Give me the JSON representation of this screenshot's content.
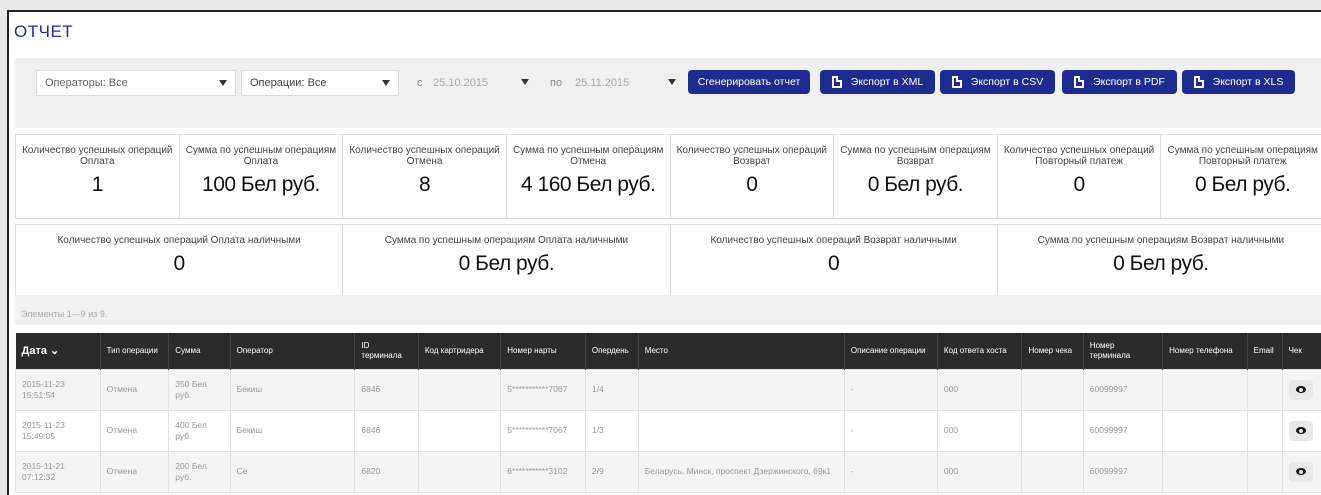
{
  "title": "ОТЧЕТ",
  "filters": {
    "operators": "Операторы: Все",
    "operations": "Операции: Все",
    "from_label": "с",
    "from_date": "25.10.2015",
    "to_label": "по",
    "to_date": "25.11.2015",
    "generate": "Сгенерировать отчет",
    "export_xml": "Экспорт в XML",
    "export_csv": "Экспорт в CSV",
    "export_pdf": "Экспорт в PDF",
    "export_xls": "Экспорт в XLS"
  },
  "stats_row1": [
    {
      "label": "Количество успешных операций Оплата",
      "value": "1"
    },
    {
      "label": "Сумма по успешным операциям Оплата",
      "value": "100 Бел руб."
    },
    {
      "label": "Количество успешных операций Отмена",
      "value": "8"
    },
    {
      "label": "Сумма по успешным операциям Отмена",
      "value": "4 160 Бел руб."
    },
    {
      "label": "Количество успешных операций Возврат",
      "value": "0"
    },
    {
      "label": "Сумма по успешным операциям Возврат",
      "value": "0 Бел руб."
    },
    {
      "label": "Количество успешных операций Повторный платеж",
      "value": "0"
    },
    {
      "label": "Сумма по успешным операциям Повторный платеж",
      "value": "0 Бел руб."
    }
  ],
  "stats_row2": [
    {
      "label": "Количество успешных операций Оплата наличными",
      "value": "0"
    },
    {
      "label": "Сумма по успешным операциям Оплата наличными",
      "value": "0 Бел руб."
    },
    {
      "label": "Количество успешных операций Возврат наличными",
      "value": "0"
    },
    {
      "label": "Сумма по успешным операциям Возврат наличными",
      "value": "0 Бел руб."
    }
  ],
  "count_text": "Элементы 1—9 из 9.",
  "table": {
    "headers": [
      "Дата",
      "Тип операции",
      "Сумма",
      "Оператор",
      "ID терминала",
      "Код картридера",
      "Номер нарты",
      "Опердень",
      "Место",
      "Описание операции",
      "Код ответа хоста",
      "Номер чека",
      "Номер терминала",
      "Номер телефона",
      "Email",
      "Чек"
    ],
    "rows": [
      [
        "2015-11-23 15:51:54",
        "Отмена",
        "350 Бел руб.",
        "Бекиш",
        "6846",
        "",
        "5***********7067",
        "1/4",
        "",
        "-",
        "000",
        "",
        "60099997",
        "",
        ""
      ],
      [
        "2015-11-23 15:49:05",
        "Отмена",
        "400 Бел руб.",
        "Бекиш",
        "6846",
        "",
        "5***********7067",
        "1/3",
        "",
        "-",
        "000",
        "",
        "60099997",
        "",
        ""
      ],
      [
        "2015-11-21 07:12:32",
        "Отмена",
        "200 Бел руб.",
        "Се",
        "6820",
        "",
        "6***********3102",
        "2/9",
        "Беларусь, Минск, проспект Дзержинского, 69к1",
        "-",
        "000",
        "",
        "60099997",
        "",
        ""
      ]
    ]
  },
  "colors": {
    "accent": "#1f2c8f",
    "header_bg": "#2b2b2b"
  }
}
